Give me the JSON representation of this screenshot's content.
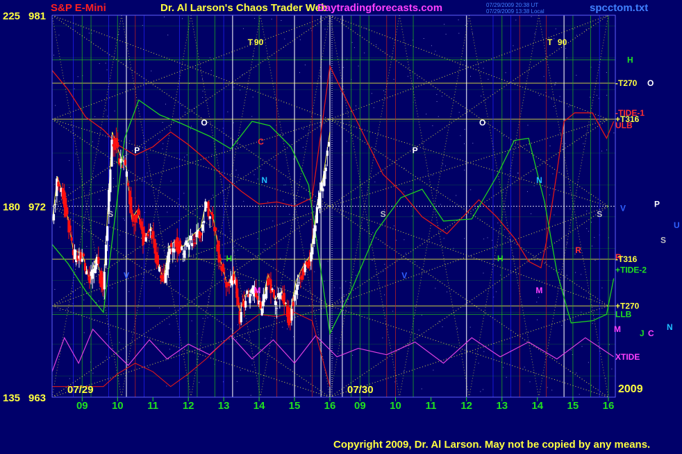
{
  "header": {
    "instrument": "S&P E-Mini",
    "title": "Dr. Al Larson's Chaos Trader Web",
    "site": "Daytradingforecasts.com",
    "stamp1": "07/29/2009 20:38 UT",
    "stamp2": "07/29/2009 13:38 Local",
    "file": "spcctom.txt"
  },
  "axis": {
    "left_labels": [
      {
        "angle": "225",
        "price": "981",
        "value": 981
      },
      {
        "angle": "180",
        "price": "972",
        "value": 972
      },
      {
        "angle": "135",
        "price": "963",
        "value": 963
      }
    ],
    "date_labels": [
      {
        "text": "07/29",
        "day": 0
      },
      {
        "text": "07/30",
        "day": 1
      }
    ],
    "year": "2009",
    "hours": [
      "09",
      "10",
      "11",
      "12",
      "13",
      "14",
      "15",
      "16",
      "09",
      "10",
      "11",
      "12",
      "13",
      "14",
      "15",
      "16"
    ]
  },
  "right_labels": [
    {
      "text": "H",
      "color": "#20e020",
      "price": 978.9
    },
    {
      "text": "-T270",
      "color": "#ffff40",
      "price": 977.8
    },
    {
      "text": "O",
      "color": "#ffffff",
      "price": 977.8
    },
    {
      "text": "-TIDE-1",
      "color": "#ff3030",
      "price": 976.4
    },
    {
      "text": "+T316",
      "color": "#ffff40",
      "price": 976.1
    },
    {
      "text": "ULB",
      "color": "#ff3030",
      "price": 975.8
    },
    {
      "text": "P",
      "color": "#ffffff",
      "price": 972.1
    },
    {
      "text": "V",
      "color": "#3060ff",
      "price": 971.9
    },
    {
      "text": "U",
      "color": "#3060ff",
      "price": 971.1
    },
    {
      "text": "S",
      "color": "#c0c0c0",
      "price": 970.4
    },
    {
      "text": "R",
      "color": "#ff3030",
      "price": 969.6
    },
    {
      "text": "-T316",
      "color": "#ffff40",
      "price": 969.5
    },
    {
      "text": "+TIDE-2",
      "color": "#20e020",
      "price": 969.0
    },
    {
      "text": "+T270",
      "color": "#ffff40",
      "price": 967.3
    },
    {
      "text": "LLB",
      "color": "#20e020",
      "price": 966.9
    },
    {
      "text": "N",
      "color": "#20c0ff",
      "price": 966.3
    },
    {
      "text": "M",
      "color": "#ff40ff",
      "price": 966.2
    },
    {
      "text": "J",
      "color": "#20e020",
      "price": 966.0
    },
    {
      "text": "C",
      "color": "#ff40ff",
      "price": 966.0
    },
    {
      "text": "XTIDE",
      "color": "#ff40ff",
      "price": 964.9
    }
  ],
  "planet_marks": [
    {
      "text": "T",
      "color": "#ffff40",
      "day": 0,
      "hour": 13.75,
      "price": 979.6
    },
    {
      "text": "90",
      "color": "#ffff40",
      "day": 0,
      "hour": 13.99,
      "price": 979.6
    },
    {
      "text": "O",
      "color": "#ffffff",
      "day": 0,
      "hour": 12.45,
      "price": 975.8
    },
    {
      "text": "P",
      "color": "#ffffff",
      "day": 0,
      "hour": 10.55,
      "price": 974.5
    },
    {
      "text": "C",
      "color": "#ff3030",
      "day": 0,
      "hour": 14.05,
      "price": 974.9
    },
    {
      "text": "N",
      "color": "#20c0ff",
      "day": 0,
      "hour": 14.15,
      "price": 973.1
    },
    {
      "text": "S",
      "color": "#c0c0c0",
      "day": 0,
      "hour": 9.8,
      "price": 971.5
    },
    {
      "text": "V",
      "color": "#3060ff",
      "day": 0,
      "hour": 10.25,
      "price": 968.6
    },
    {
      "text": "M",
      "color": "#ff40ff",
      "day": 0,
      "hour": 13.95,
      "price": 967.9
    },
    {
      "text": "H",
      "color": "#20e020",
      "day": 0,
      "hour": 13.15,
      "price": 969.4
    },
    {
      "text": "O",
      "color": "#ffffff",
      "day": 1,
      "hour": 12.45,
      "price": 975.8
    },
    {
      "text": "P",
      "color": "#ffffff",
      "day": 1,
      "hour": 10.55,
      "price": 974.5
    },
    {
      "text": "S",
      "color": "#c0c0c0",
      "day": 1,
      "hour": 9.65,
      "price": 971.5
    },
    {
      "text": "V",
      "color": "#3060ff",
      "day": 1,
      "hour": 10.25,
      "price": 968.6
    },
    {
      "text": "T",
      "color": "#ffff40",
      "day": 1,
      "hour": 14.35,
      "price": 979.6
    },
    {
      "text": "90",
      "color": "#ffff40",
      "day": 1,
      "hour": 14.7,
      "price": 979.6
    },
    {
      "text": "N",
      "color": "#20c0ff",
      "day": 1,
      "hour": 14.05,
      "price": 973.1
    },
    {
      "text": "M",
      "color": "#ff40ff",
      "day": 1,
      "hour": 14.05,
      "price": 967.9
    },
    {
      "text": "H",
      "color": "#20e020",
      "day": 1,
      "hour": 12.95,
      "price": 969.4
    },
    {
      "text": "R",
      "color": "#ff3030",
      "day": 1,
      "hour": 15.15,
      "price": 969.8
    },
    {
      "text": "S",
      "color": "#c0c0c0",
      "day": 1,
      "hour": 15.75,
      "price": 971.5
    }
  ],
  "footer": {
    "copyright": "Copyright 2009, Dr. Al Larson. May not be copied by any means."
  },
  "colors": {
    "background": "#00006a",
    "plot_bg": "#000066",
    "candle_up": "#ffffff",
    "candle_down": "#ff1010",
    "grid_green": "#20b020",
    "grid_red": "#c02020",
    "grid_white": "#ffffff",
    "dotted_yellow": "#ffff40",
    "tide_red": "#e01818",
    "tide_green": "#20d020",
    "xtide": "#e040e0"
  },
  "chart_data": {
    "type": "candlestick",
    "instrument": "S&P E-Mini",
    "ylim": [
      963,
      981
    ],
    "x_sessions": [
      "07/29",
      "07/30"
    ],
    "hour_range": [
      8.15,
      16.0
    ],
    "price_vertices": [
      [
        8.15,
        971.0
      ],
      [
        8.3,
        973.2
      ],
      [
        8.5,
        972.2
      ],
      [
        8.75,
        969.7
      ],
      [
        9.0,
        969.6
      ],
      [
        9.2,
        968.4
      ],
      [
        9.4,
        969.4
      ],
      [
        9.6,
        968.0
      ],
      [
        9.85,
        975.3
      ],
      [
        10.05,
        974.3
      ],
      [
        10.25,
        973.6
      ],
      [
        10.4,
        971.2
      ],
      [
        10.55,
        971.6
      ],
      [
        10.75,
        970.3
      ],
      [
        10.95,
        970.8
      ],
      [
        11.15,
        969.0
      ],
      [
        11.3,
        968.4
      ],
      [
        11.45,
        969.9
      ],
      [
        11.65,
        970.2
      ],
      [
        11.85,
        969.9
      ],
      [
        12.1,
        970.4
      ],
      [
        12.35,
        970.8
      ],
      [
        12.5,
        972.0
      ],
      [
        12.7,
        971.3
      ],
      [
        12.9,
        969.3
      ],
      [
        13.1,
        968.1
      ],
      [
        13.3,
        968.7
      ],
      [
        13.45,
        966.8
      ],
      [
        13.6,
        967.6
      ],
      [
        13.85,
        968.0
      ],
      [
        14.05,
        966.9
      ],
      [
        14.25,
        968.6
      ],
      [
        14.45,
        967.4
      ],
      [
        14.65,
        967.8
      ],
      [
        14.85,
        966.6
      ],
      [
        15.05,
        968.3
      ],
      [
        15.25,
        969.0
      ],
      [
        15.45,
        969.5
      ],
      [
        15.65,
        972.0
      ],
      [
        15.8,
        973.1
      ],
      [
        16.0,
        975.3
      ]
    ],
    "tide1_vertices": [
      [
        8.15,
        978.4
      ],
      [
        8.6,
        977.5
      ],
      [
        9.1,
        976.2
      ],
      [
        9.6,
        975.6
      ],
      [
        10.0,
        974.9
      ],
      [
        10.5,
        974.4
      ],
      [
        11.0,
        974.8
      ],
      [
        11.5,
        975.5
      ],
      [
        12.0,
        974.9
      ],
      [
        12.5,
        974.2
      ],
      [
        13.0,
        973.4
      ],
      [
        13.5,
        972.7
      ],
      [
        14.0,
        972.1
      ],
      [
        14.5,
        972.2
      ],
      [
        15.0,
        972.0
      ],
      [
        15.5,
        972.4
      ],
      [
        16.0,
        978.6
      ],
      [
        17.5,
        973.5
      ],
      [
        18.0,
        972.7
      ],
      [
        18.6,
        971.5
      ],
      [
        19.3,
        970.7
      ],
      [
        20.2,
        972.3
      ],
      [
        20.7,
        971.5
      ],
      [
        21.2,
        970.5
      ],
      [
        21.6,
        969.4
      ],
      [
        21.95,
        969.1
      ],
      [
        22.1,
        970.3
      ],
      [
        22.4,
        973.6
      ],
      [
        22.6,
        976.0
      ],
      [
        22.9,
        976.4
      ],
      [
        23.4,
        976.4
      ],
      [
        23.8,
        975.2
      ],
      [
        24.0,
        976.0
      ]
    ],
    "tide2_vertices": [
      [
        8.15,
        970.2
      ],
      [
        8.6,
        969.3
      ],
      [
        9.1,
        968.0
      ],
      [
        9.6,
        967.0
      ],
      [
        10.2,
        975.2
      ],
      [
        10.6,
        977.0
      ],
      [
        11.2,
        976.3
      ],
      [
        11.8,
        975.9
      ],
      [
        12.6,
        975.3
      ],
      [
        13.2,
        974.7
      ],
      [
        13.8,
        976.0
      ],
      [
        14.3,
        975.8
      ],
      [
        14.9,
        974.8
      ],
      [
        15.4,
        973.0
      ],
      [
        16.0,
        966.0
      ],
      [
        16.6,
        968.0
      ],
      [
        17.3,
        970.8
      ],
      [
        18.0,
        972.4
      ],
      [
        18.6,
        972.8
      ],
      [
        19.2,
        971.3
      ],
      [
        20.0,
        971.4
      ],
      [
        20.7,
        973.4
      ],
      [
        21.2,
        975.1
      ],
      [
        21.6,
        975.2
      ],
      [
        22.05,
        972.2
      ],
      [
        22.4,
        968.9
      ],
      [
        22.8,
        966.5
      ],
      [
        23.4,
        966.6
      ],
      [
        23.8,
        966.9
      ],
      [
        24.0,
        968.6
      ]
    ],
    "xtide_vertices": [
      [
        8.15,
        964.2
      ],
      [
        8.5,
        965.8
      ],
      [
        8.9,
        964.6
      ],
      [
        9.3,
        966.2
      ],
      [
        9.8,
        965.3
      ],
      [
        10.3,
        964.5
      ],
      [
        10.9,
        965.7
      ],
      [
        11.4,
        964.8
      ],
      [
        12.0,
        965.5
      ],
      [
        12.6,
        965.0
      ],
      [
        13.2,
        965.9
      ],
      [
        13.8,
        964.8
      ],
      [
        14.4,
        965.7
      ],
      [
        15.0,
        964.6
      ],
      [
        15.6,
        965.9
      ],
      [
        16.2,
        964.9
      ],
      [
        16.8,
        965.3
      ],
      [
        17.6,
        965.0
      ],
      [
        18.4,
        965.6
      ],
      [
        19.2,
        964.6
      ],
      [
        20.0,
        965.8
      ],
      [
        20.8,
        964.9
      ],
      [
        21.6,
        965.6
      ],
      [
        22.4,
        964.8
      ],
      [
        23.2,
        965.8
      ],
      [
        24.0,
        964.9
      ]
    ],
    "horizontal_levels": [
      963,
      966.9,
      967.3,
      969.5,
      972,
      976.1,
      977.8,
      978.9,
      981
    ]
  }
}
